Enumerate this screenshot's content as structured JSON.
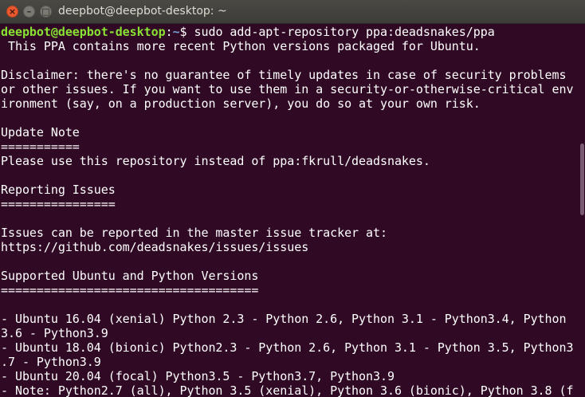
{
  "window": {
    "title": "deepbot@deepbot-desktop: ~"
  },
  "terminal": {
    "prompt": {
      "user_host": "deepbot@deepbot-desktop",
      "colon": ":",
      "path": "~",
      "dollar": "$",
      "command": " sudo add-apt-repository ppa:deadsnakes/ppa"
    },
    "lines": [
      " This PPA contains more recent Python versions packaged for Ubuntu.",
      "",
      "Disclaimer: there's no guarantee of timely updates in case of security problems",
      "or other issues. If you want to use them in a security-or-otherwise-critical env",
      "ironment (say, on a production server), you do so at your own risk.",
      "",
      "Update Note",
      "===========",
      "Please use this repository instead of ppa:fkrull/deadsnakes.",
      "",
      "Reporting Issues",
      "================",
      "",
      "Issues can be reported in the master issue tracker at:",
      "https://github.com/deadsnakes/issues/issues",
      "",
      "Supported Ubuntu and Python Versions",
      "====================================",
      "",
      "- Ubuntu 16.04 (xenial) Python 2.3 - Python 2.6, Python 3.1 - Python3.4, Python",
      "3.6 - Python3.9",
      "- Ubuntu 18.04 (bionic) Python2.3 - Python 2.6, Python 3.1 - Python 3.5, Python3",
      ".7 - Python3.9",
      "- Ubuntu 20.04 (focal) Python3.5 - Python3.7, Python3.9",
      "- Note: Python2.7 (all), Python 3.5 (xenial), Python 3.6 (bionic), Python 3.8 (f"
    ]
  }
}
